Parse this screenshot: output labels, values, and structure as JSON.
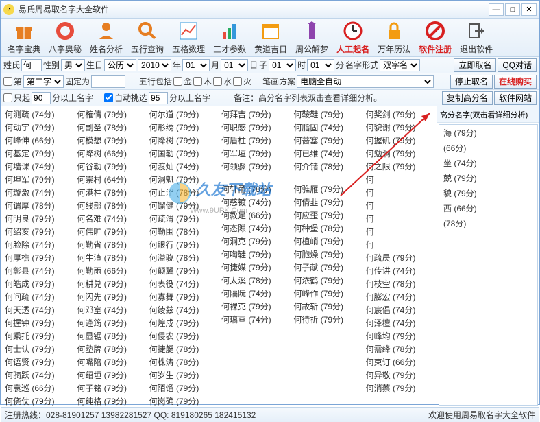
{
  "window": {
    "title": "易氏周易取名字大全软件"
  },
  "toolbar": [
    {
      "label": "名字宝典",
      "color": "#e67e22",
      "icon": "gift"
    },
    {
      "label": "八字奥秘",
      "color": "#e74c3c",
      "icon": "ring"
    },
    {
      "label": "姓名分析",
      "color": "#e67e22",
      "icon": "person"
    },
    {
      "label": "五行查询",
      "color": "#e67e22",
      "icon": "search"
    },
    {
      "label": "五格数理",
      "color": "#3498db",
      "icon": "chart"
    },
    {
      "label": "三才参数",
      "color": "#27ae60",
      "icon": "bars"
    },
    {
      "label": "黄道吉日",
      "color": "#f39c12",
      "icon": "calendar"
    },
    {
      "label": "周公解梦",
      "color": "#8e44ad",
      "icon": "tower"
    },
    {
      "label": "人工起名",
      "color": "#d82020",
      "icon": "clock",
      "red": true
    },
    {
      "label": "万年历法",
      "color": "#f39c12",
      "icon": "lock"
    },
    {
      "label": "软件注册",
      "color": "#d82020",
      "icon": "no",
      "red": true
    },
    {
      "label": "退出软件",
      "color": "#555",
      "icon": "exit"
    }
  ],
  "form1": {
    "surname_lbl": "姓氏",
    "surname_val": "何",
    "gender_lbl": "性别",
    "gender_val": "男",
    "birth_lbl": "生日",
    "cal_val": "公历",
    "year_val": "2010",
    "year_lbl": "年",
    "month_val": "01",
    "month_lbl": "月",
    "day_val": "01",
    "day_lbl": "日",
    "zi_lbl": "子",
    "hour_val": "01",
    "hour_lbl": "时",
    "min_val": "01",
    "min_lbl": "分",
    "nameform_lbl": "名字形式",
    "nameform_val": "双字名",
    "btn_go": "立即取名",
    "btn_qq": "QQ对话"
  },
  "form2": {
    "di_lbl": "第",
    "second_val": "第二字",
    "fixed_lbl": "固定为",
    "fixed_val": "",
    "wuxing_lbl": "五行包括",
    "jin": "金",
    "mu": "木",
    "shui": "水",
    "huo": "火",
    "bihua_lbl": "笔画方案",
    "bihua_val": "电脑全自动",
    "btn_stop": "停止取名",
    "btn_buy": "在线购买"
  },
  "form3": {
    "only_lbl": "只起",
    "only_val": "90",
    "only_suf": "分以上名字",
    "auto_lbl": "自动挑选",
    "auto_val": "95",
    "auto_suf": "分以上名字",
    "note": "备注：高分名字列表双击查看详细分析。",
    "btn_copy": "复制高分名",
    "btn_site": "软件网站"
  },
  "sidehead": "高分名字(双击看详细分析)",
  "sidelist": [
    "海 (79分)",
    "(66分)",
    "坐 (74分)",
    "兢 (79分)",
    "貌 (79分)",
    "西 (66分)",
    "(78分)"
  ],
  "names": {
    "col0": [
      "何测疏 (74分)",
      "何动宇 (79分)",
      "何峰伸 (66分)",
      "何基定 (79分)",
      "何墙课 (74分)",
      "何坦军 (79分)",
      "何璇激 (74分)",
      "何谓厚 (78分)",
      "何明良 (79分)",
      "何绍亥 (79分)",
      "何脸除 (74分)",
      "何厚樵 (79分)",
      "何彰县 (74分)",
      "何皓成 (79分)",
      "何问疏 (74分)",
      "何天透 (74分)",
      "何握钟 (79分)",
      "何乘托 (79分)",
      "何士认 (79分)",
      "何语贤 (79分)",
      "何骑跃 (74分)",
      "何袁巡 (66分)",
      "何侥仗 (79分)"
    ],
    "col1": [
      "何榷倩 (79分)",
      "何副圣 (78分)",
      "何模想 (79分)",
      "何降树 (66分)",
      "何谷勒 (79分)",
      "何崇村 (64分)",
      "何港柱 (78分)",
      "何线部 (78分)",
      "何名难 (74分)",
      "何伟旷 (79分)",
      "何勤省 (78分)",
      "何牛渣 (78分)",
      "何勤雨 (66分)",
      "何耕兑 (79分)",
      "何闪先 (79分)",
      "何邓室 (74分)",
      "何逢筠 (79分)",
      "何显锯 (78分)",
      "何塾牌 (78分)",
      "何嘴陪 (78分)",
      "何绍垣 (79分)",
      "何子铭 (79分)",
      "何纯格 (79分)"
    ],
    "col2": [
      "何尔道 (79分)",
      "何形绣 (79分)",
      "何降树 (79分)",
      "何国勒 (79分)",
      "何渡灿 (74分)",
      "何洞魁 (79分)",
      "何止涩 (78分)",
      "何馏健 (79分)",
      "何疏渭 (79分)",
      "何勤围 (78分)",
      "何眼行 (79分)",
      "何溢骁 (78分)",
      "何颠翼 (79分)",
      "何表役 (74分)",
      "何寡舞 (79分)",
      "何绫兹 (74分)",
      "何煌戍 (79分)",
      "何侵农 (79分)",
      "何捷艇 (78分)",
      "何株涛 (78分)",
      "何岁生 (79分)",
      "何陌馏 (79分)",
      "何岗确 (79分)"
    ],
    "col3": [
      "何拜吉 (79分)",
      "何职感 (79分)",
      "何盾柱 (79分)",
      "何军垣 (79分)",
      "何领骤 (79分)",
      "",
      "",
      "",
      "",
      "",
      "",
      "",
      "何轩甬 (78分)",
      "何慈镀 (74分)",
      "何教足 (66分)",
      "何态隙 (74分)",
      "何洞克 (79分)",
      "何啕鞋 (79分)",
      "何捷媒 (79分)",
      "何太溪 (78分)",
      "何隔阮 (74分)",
      "何裸克 (79分)",
      "何璃亘 (74分)"
    ],
    "col4": [
      "何鞍鞋 (79分)",
      "何脂固 (74分)",
      "何蔷塞 (79分)",
      "何已维 (74分)",
      "何介锗 (78分)",
      "",
      "",
      "",
      "",
      "",
      "",
      "",
      "何骓雁 (79分)",
      "何倩韭 (79分)",
      "何应歪 (79分)",
      "何种堡 (78分)",
      "何植峭 (79分)",
      "何胞燥 (79分)",
      "何子献 (79分)",
      "何浓鹤 (79分)",
      "何峰作 (79分)",
      "何故斩 (79分)",
      "何待祈 (79分)"
    ],
    "col5": [
      "何奖剑 (79分)",
      "何貌谢 (79分)",
      "何握矶 (79分)",
      "何勉洞 (79分)",
      "何之限 (79分)",
      "何",
      "何",
      "何",
      "何",
      "何",
      "何",
      "何疏昃 (79分)",
      "何传讲 (74分)",
      "何枝空 (78分)",
      "何膨宏 (74分)",
      "何宸倡 (74分)",
      "何泽檀 (74分)",
      "何峰均 (79分)",
      "何需绛 (78分)",
      "何束订 (66分)",
      "何异敬 (79分)",
      "何消蔡 (79分)",
      ""
    ]
  },
  "status": {
    "left": "注册热线：028-81901257  13982281527  QQ: 819180265  182415132",
    "right": "欢迎使用周易取名字大全软件"
  },
  "watermark": {
    "big": "久友下载站",
    "small": "Www.9UPK.Com"
  }
}
